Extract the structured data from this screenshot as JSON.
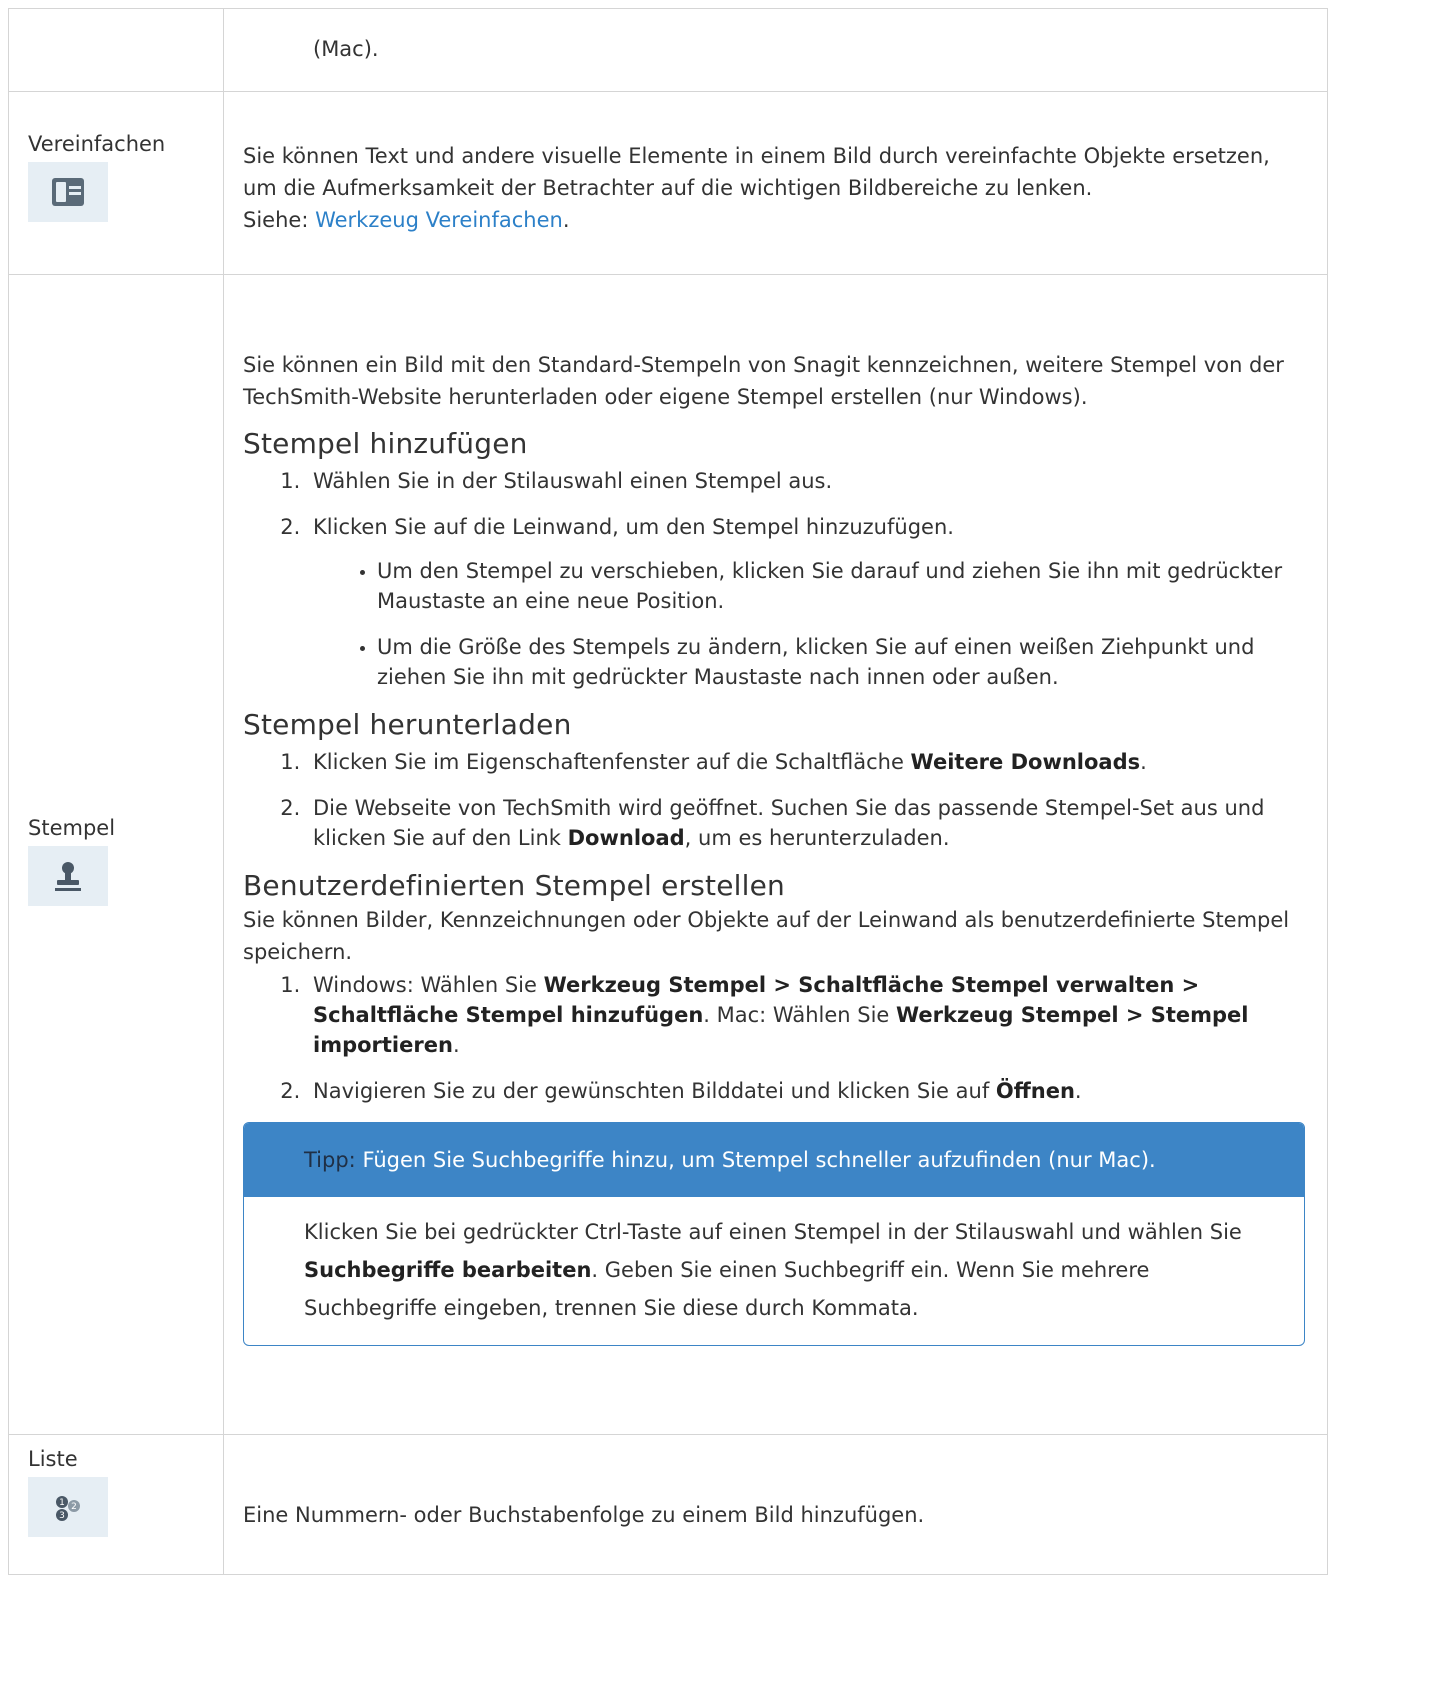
{
  "rows": {
    "mac": {
      "label": "",
      "text": "(Mac)."
    },
    "simplify": {
      "label": "Vereinfachen",
      "icon": "simplify-icon",
      "text": "Sie können Text und andere visuelle Elemente in einem Bild durch vereinfachte Objekte ersetzen, um die Aufmerksamkeit der Betrachter auf die wichtigen Bildbereiche zu lenken.",
      "see_prefix": "Siehe: ",
      "see_link": "Werkzeug Vereinfachen",
      "see_suffix": "."
    },
    "stamp": {
      "label": "Stempel",
      "icon": "stamp-icon",
      "intro": "Sie können ein Bild mit den Standard-Stempeln von Snagit kennzeichnen, weitere Stempel von der TechSmith-Website herunterladen oder eigene Stempel erstellen (nur Windows).",
      "add": {
        "heading": "Stempel hinzufügen",
        "step1": "Wählen Sie in der Stilauswahl einen Stempel aus.",
        "step2": "Klicken Sie auf die Leinwand, um den Stempel hinzuzufügen.",
        "bullet1": "Um den Stempel zu verschieben, klicken Sie darauf und ziehen Sie ihn mit gedrückter Maustaste an eine neue Position.",
        "bullet2": "Um die Größe des Stempels zu ändern, klicken Sie auf einen weißen Ziehpunkt und ziehen Sie ihn mit gedrückter Maustaste nach innen oder außen."
      },
      "download": {
        "heading": "Stempel herunterladen",
        "step1_pre": "Klicken Sie im Eigenschaftenfenster auf die Schaltfläche ",
        "step1_bold": "Weitere Downloads",
        "step1_post": ".",
        "step2_pre": "Die Webseite von TechSmith wird geöffnet. Suchen Sie das passende Stempel-Set aus und klicken Sie auf den Link ",
        "step2_bold": "Download",
        "step2_post": ", um es herunterzuladen."
      },
      "custom": {
        "heading": "Benutzerdefinierten Stempel erstellen",
        "intro": "Sie können Bilder, Kennzeichnungen oder Objekte auf der Leinwand als benutzerdefinierte Stempel speichern.",
        "step1_a": "Windows: Wählen Sie ",
        "step1_b": "Werkzeug Stempel > Schaltfläche Stempel verwalten > Schaltfläche Stempel hinzufügen",
        "step1_c": ". Mac: Wählen Sie ",
        "step1_d": "Werkzeug Stempel > Stempel importieren",
        "step1_e": ".",
        "step2_pre": "Navigieren Sie zu der gewünschten Bilddatei und klicken Sie auf ",
        "step2_bold": "Öffnen",
        "step2_post": "."
      },
      "tip": {
        "label": "Tipp:",
        "title": " Fügen Sie Suchbegriffe hinzu, um Stempel schneller aufzufinden (nur Mac).",
        "body_pre": "Klicken Sie bei gedrückter Ctrl-Taste auf einen Stempel in der Stilauswahl und wählen Sie ",
        "body_bold": "Suchbegriffe bearbeiten",
        "body_post": ". Geben Sie einen Suchbegriff ein. Wenn Sie mehrere Suchbegriffe eingeben, trennen Sie diese durch Kommata."
      }
    },
    "list": {
      "label": "Liste",
      "icon": "numbered-list-icon",
      "text": "Eine Nummern- oder Buchstabenfolge zu einem Bild hinzufügen."
    }
  },
  "colors": {
    "link": "#2c80c8",
    "tip_header": "#3d85c6",
    "icon_tile": "#e6eef4",
    "border": "#d5d5d5"
  }
}
